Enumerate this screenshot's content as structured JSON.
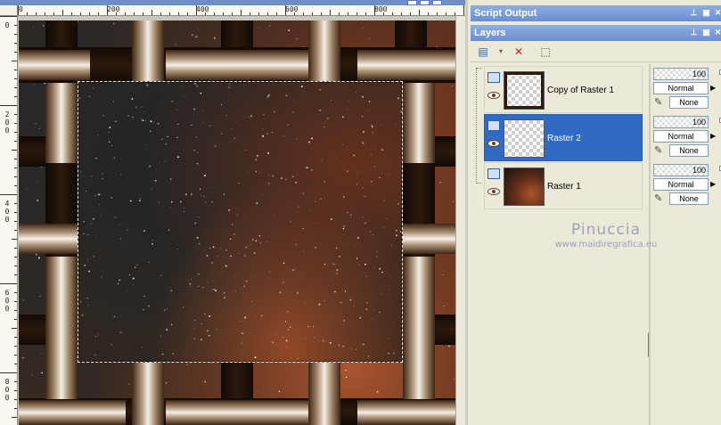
{
  "canvas": {
    "ruler_h_labels": [
      "200",
      "400",
      "600",
      "800"
    ],
    "ruler_v_labels": [
      "0",
      "200",
      "400",
      "600",
      "800"
    ]
  },
  "panels": {
    "script_output_title": "Script Output",
    "layers_title": "Layers"
  },
  "layers": [
    {
      "name": "Copy of Raster 1",
      "opacity": "100",
      "blend": "Normal",
      "mask": "None",
      "selected": false
    },
    {
      "name": "Raster 2",
      "opacity": "100",
      "blend": "Normal",
      "mask": "None",
      "selected": true
    },
    {
      "name": "Raster 1",
      "opacity": "100",
      "blend": "Normal",
      "mask": "None",
      "selected": false
    }
  ],
  "watermark": {
    "name": "Pinuccia",
    "url": "www.maidiregrafica.eu"
  },
  "icons": {
    "title_buttons": [
      "pin-icon",
      "float-icon",
      "close-icon"
    ],
    "layers_toolbar": [
      "new-layer-icon",
      "delete-layer-icon",
      "edit-selection-icon"
    ]
  },
  "colors": {
    "title_bar": "#6a8fd0",
    "selected_row": "#316ac5",
    "panel_bg": "#ece9d8"
  }
}
